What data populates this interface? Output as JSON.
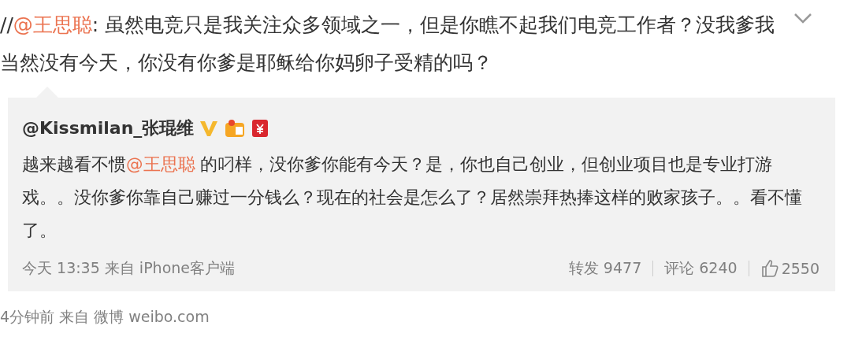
{
  "post": {
    "segments": [
      {
        "kind": "text",
        "text": "//"
      },
      {
        "kind": "mention",
        "text": "@王思聪"
      },
      {
        "kind": "text",
        "text": ": 虽然电竞只是我关注众多领域之一，但是你瞧不起我们电竞工作者？没我爹我当然没有今天，你没有你爹是耶稣给你妈卵子受精的吗？"
      }
    ]
  },
  "quoted": {
    "author": "@Kissmilan_张琨维",
    "body": [
      {
        "kind": "text",
        "text": "越来越看不惯"
      },
      {
        "kind": "mention",
        "text": "@王思聪"
      },
      {
        "kind": "text",
        "text": " 的叼样，没你爹你能有今天？是，你也自己创业，但创业项目也是专业打游戏。。没你爹你靠自己赚过一分钱么？现在的社会是怎么了？居然崇拜热捧这样的败家孩子。。看不懂了。"
      }
    ],
    "meta": "今天 13:35 来自 iPhone客户端",
    "repost": "转发 9477",
    "comments": "评论 6240",
    "likes": "2550"
  },
  "footer": "4分钟前 来自 微博 weibo.com"
}
